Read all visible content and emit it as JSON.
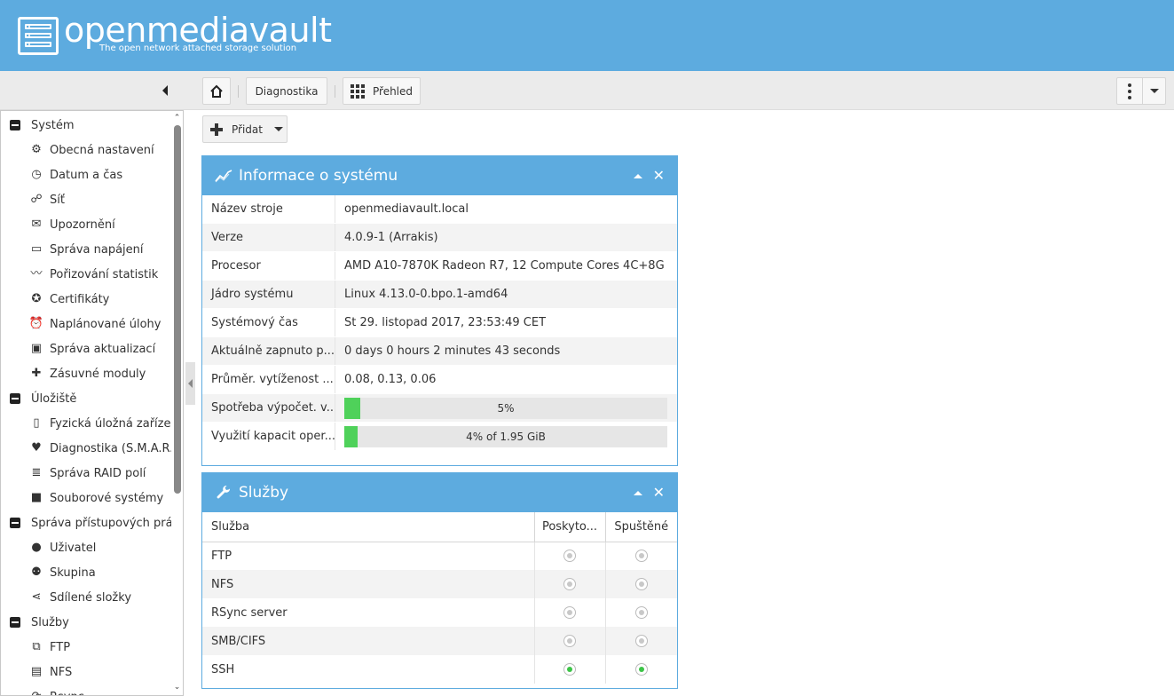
{
  "header": {
    "title": "openmediavault",
    "subtitle": "The open network attached storage solution"
  },
  "toolbar": {
    "breadcrumb_diagnostics": "Diagnostika",
    "breadcrumb_overview": "Přehled"
  },
  "sidebar": {
    "categories": [
      {
        "label": "Systém",
        "items": [
          {
            "label": "Obecná nastavení",
            "icon": "gears-icon"
          },
          {
            "label": "Datum a čas",
            "icon": "clock-icon"
          },
          {
            "label": "Síť",
            "icon": "network-icon"
          },
          {
            "label": "Upozornění",
            "icon": "envelope-icon"
          },
          {
            "label": "Správa napájení",
            "icon": "power-icon"
          },
          {
            "label": "Pořizování statistik",
            "icon": "chart-line-icon"
          },
          {
            "label": "Certifikáty",
            "icon": "certificate-icon"
          },
          {
            "label": "Naplánované úlohy",
            "icon": "alarm-clock-icon"
          },
          {
            "label": "Správa aktualizací",
            "icon": "archive-icon"
          },
          {
            "label": "Zásuvné moduly",
            "icon": "puzzle-icon"
          }
        ]
      },
      {
        "label": "Úložiště",
        "items": [
          {
            "label": "Fyzická úložná zařízení",
            "icon": "hdd-icon"
          },
          {
            "label": "Diagnostika (S.M.A.R.T.",
            "icon": "heartbeat-icon"
          },
          {
            "label": "Správa RAID polí",
            "icon": "database-icon"
          },
          {
            "label": "Souborové systémy",
            "icon": "folder-icon"
          }
        ]
      },
      {
        "label": "Správa přístupových práv",
        "items": [
          {
            "label": "Uživatel",
            "icon": "user-icon"
          },
          {
            "label": "Skupina",
            "icon": "users-icon"
          },
          {
            "label": "Sdílené složky",
            "icon": "share-icon"
          }
        ]
      },
      {
        "label": "Služby",
        "items": [
          {
            "label": "FTP",
            "icon": "ftp-icon"
          },
          {
            "label": "NFS",
            "icon": "file-icon"
          },
          {
            "label": "Rsync",
            "icon": "sync-icon"
          }
        ]
      }
    ]
  },
  "add_button": {
    "label": "Přidat"
  },
  "sysinfo": {
    "title": "Informace o systému",
    "rows": [
      {
        "key": "Název stroje",
        "value": "openmediavault.local"
      },
      {
        "key": "Verze",
        "value": "4.0.9-1 (Arrakis)"
      },
      {
        "key": "Procesor",
        "value": "AMD A10-7870K Radeon R7, 12 Compute Cores 4C+8G"
      },
      {
        "key": "Jádro systému",
        "value": "Linux 4.13.0-0.bpo.1-amd64"
      },
      {
        "key": "Systémový čas",
        "value": "St 29. listopad 2017, 23:53:49 CET"
      },
      {
        "key": "Aktuálně zapnuto p...",
        "value": "0 days 0 hours 2 minutes 43 seconds"
      },
      {
        "key": "Průměr. vytíženost ...",
        "value": "0.08, 0.13, 0.06"
      }
    ],
    "cpu": {
      "key": "Spotřeba výpočet. v...",
      "text": "5%",
      "fraction": 0.05
    },
    "memory": {
      "key": "Využití kapacit oper...",
      "text": "4% of 1.95 GiB",
      "fraction": 0.04
    }
  },
  "services": {
    "title": "Služby",
    "headers": {
      "service": "Služba",
      "enabled": "Poskyto...",
      "running": "Spuštěné"
    },
    "rows": [
      {
        "name": "FTP",
        "enabled": false,
        "running": false
      },
      {
        "name": "NFS",
        "enabled": false,
        "running": false
      },
      {
        "name": "RSync server",
        "enabled": false,
        "running": false
      },
      {
        "name": "SMB/CIFS",
        "enabled": false,
        "running": false
      },
      {
        "name": "SSH",
        "enabled": true,
        "running": true
      }
    ]
  },
  "colors": {
    "brand": "#5dabdf",
    "progress": "#4fd15a",
    "status_on": "#3cc447"
  }
}
